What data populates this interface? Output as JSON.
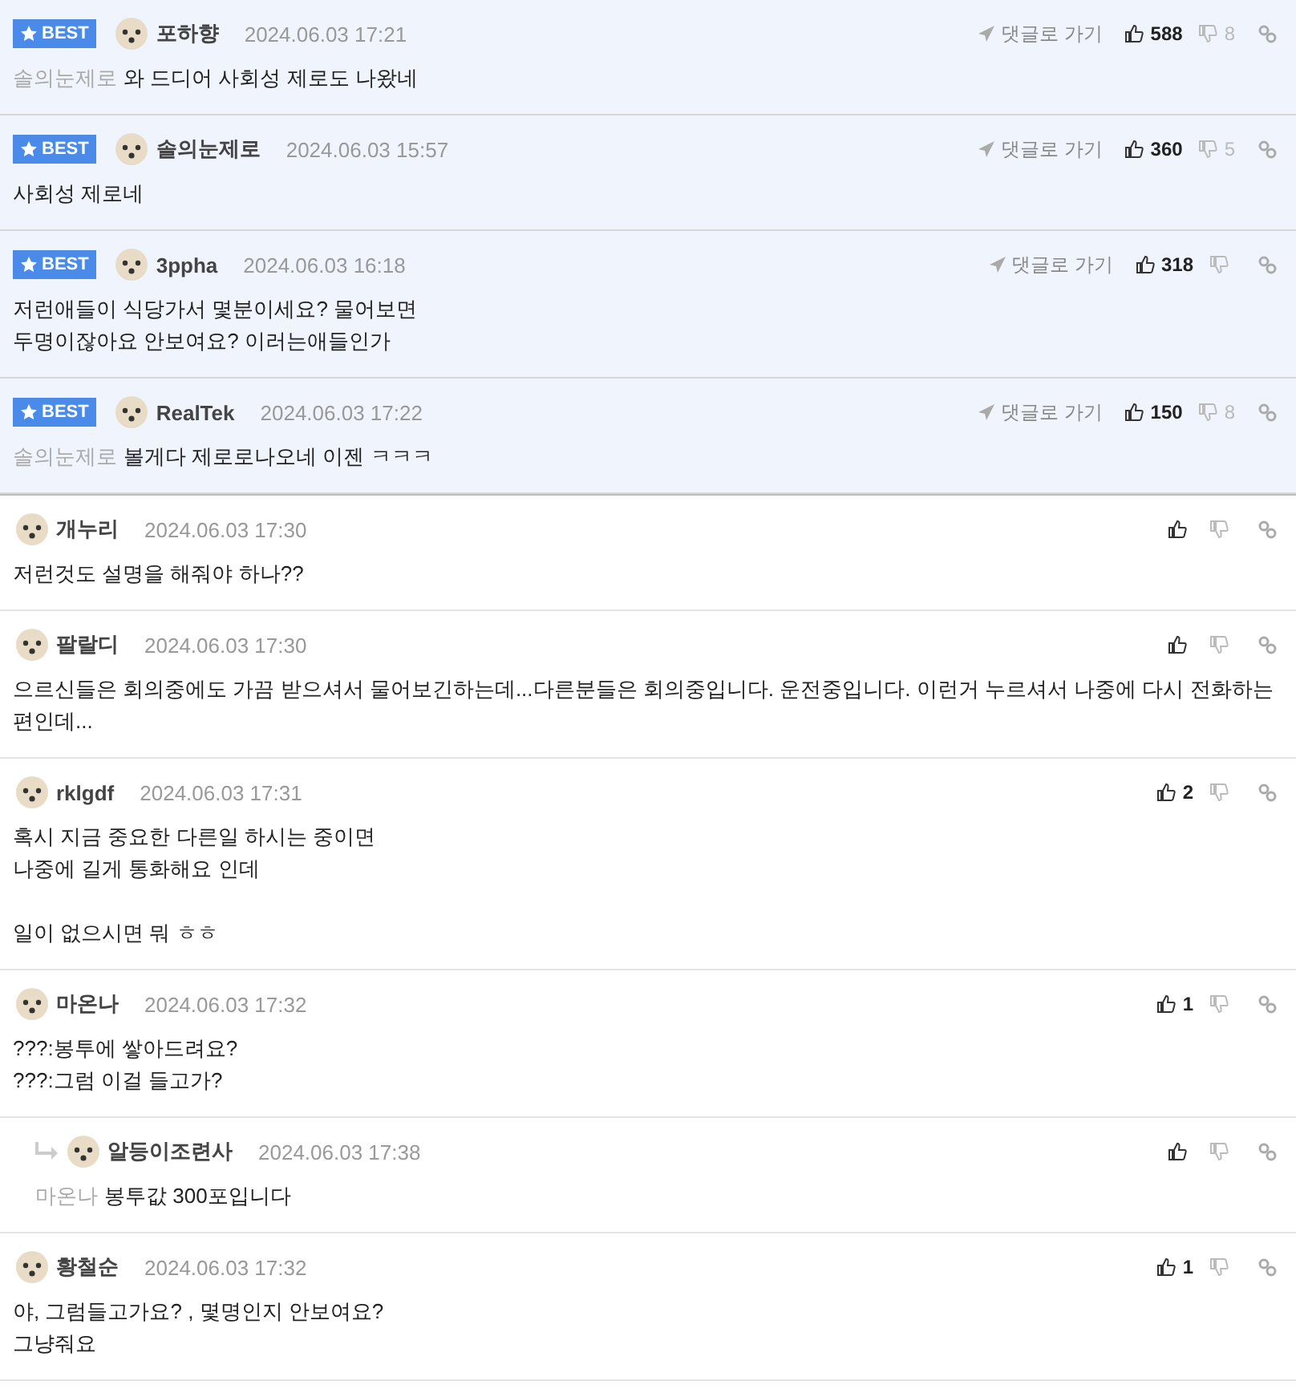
{
  "comments": [
    {
      "best": true,
      "reply": false,
      "badge": "BEST",
      "author": "포하향",
      "date": "2024.06.03 17:21",
      "goto": "댓글로 가기",
      "likes": "588",
      "dislikes": "8",
      "mention": "솔의눈제로",
      "body": [
        "와 드디어 사회성 제로도 나왔네"
      ]
    },
    {
      "best": true,
      "reply": false,
      "badge": "BEST",
      "author": "솔의눈제로",
      "date": "2024.06.03 15:57",
      "goto": "댓글로 가기",
      "likes": "360",
      "dislikes": "5",
      "body": [
        "사회성 제로네"
      ]
    },
    {
      "best": true,
      "reply": false,
      "badge": "BEST",
      "author": "3ppha",
      "date": "2024.06.03 16:18",
      "goto": "댓글로 가기",
      "likes": "318",
      "body": [
        "저런애들이 식당가서 몇분이세요? 물어보면\n두명이잖아요 안보여요? 이러는애들인가"
      ]
    },
    {
      "best": true,
      "reply": false,
      "badge": "BEST",
      "author": "RealTek",
      "date": "2024.06.03 17:22",
      "goto": "댓글로 가기",
      "likes": "150",
      "dislikes": "8",
      "mention": "솔의눈제로",
      "body": [
        "볼게다 제로로나오네 이젠 ㅋㅋㅋ"
      ]
    },
    {
      "best": false,
      "reply": false,
      "author": "개누리",
      "date": "2024.06.03 17:30",
      "body": [
        "저런것도 설명을 해줘야 하나??"
      ]
    },
    {
      "best": false,
      "reply": false,
      "author": "팔랄디",
      "date": "2024.06.03 17:30",
      "body": [
        "으르신들은 회의중에도 가끔 받으셔서 물어보긴하는데...다른분들은 회의중입니다. 운전중입니다. 이런거 누르셔서 나중에 다시 전화하는 편인데..."
      ]
    },
    {
      "best": false,
      "reply": false,
      "author": "rklgdf",
      "date": "2024.06.03 17:31",
      "likes": "2",
      "body": [
        "혹시 지금 중요한 다른일 하시는 중이면\n나중에 길게 통화해요 인데",
        "일이 없으시면 뭐 ㅎㅎ"
      ]
    },
    {
      "best": false,
      "reply": false,
      "author": "마온나",
      "date": "2024.06.03 17:32",
      "likes": "1",
      "body": [
        "???:봉투에 쌓아드려요?\n???:그럼 이걸 들고가?"
      ]
    },
    {
      "best": false,
      "reply": true,
      "author": "알등이조련사",
      "date": "2024.06.03 17:38",
      "mention": "마온나",
      "body": [
        "봉투값 300포입니다"
      ]
    },
    {
      "best": false,
      "reply": false,
      "author": "황철순",
      "date": "2024.06.03 17:32",
      "likes": "1",
      "body": [
        "야, 그럼들고가요? , 몇명인지 안보여요?\n그냥줘요"
      ]
    }
  ]
}
